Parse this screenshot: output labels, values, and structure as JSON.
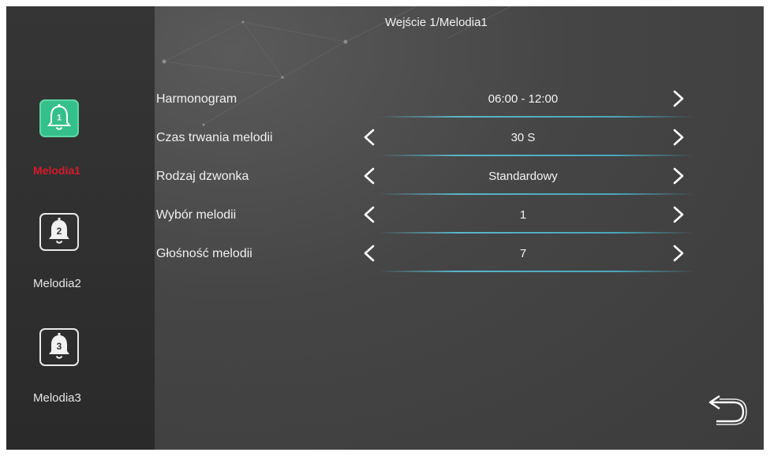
{
  "header": {
    "title": "Wejście 1/Melodia1"
  },
  "sidebar": {
    "items": [
      {
        "label": "Melodia1",
        "number": "1",
        "active": true
      },
      {
        "label": "Melodia2",
        "number": "2",
        "active": false
      },
      {
        "label": "Melodia3",
        "number": "3",
        "active": false
      }
    ]
  },
  "settings": [
    {
      "label": "Harmonogram",
      "value": "06:00 - 12:00",
      "has_left_arrow": false
    },
    {
      "label": "Czas trwania melodii",
      "value": "30 S",
      "has_left_arrow": true
    },
    {
      "label": "Rodzaj dzwonka",
      "value": "Standardowy",
      "has_left_arrow": true
    },
    {
      "label": "Wybór melodii",
      "value": "1",
      "has_left_arrow": true
    },
    {
      "label": "Głośność melodii",
      "value": "7",
      "has_left_arrow": true
    }
  ],
  "icons": {
    "bell": "bell-icon",
    "prev": "chevron-left-icon",
    "next": "chevron-right-icon",
    "back": "back-arrow-icon"
  },
  "colors": {
    "active_tile": "#34c08a",
    "active_label": "#d8192b",
    "underline": "#5ab6c8",
    "text": "#f0f0f0"
  }
}
